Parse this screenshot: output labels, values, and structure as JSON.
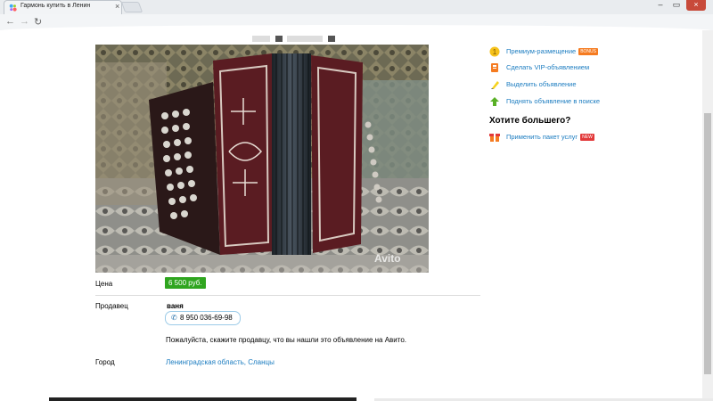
{
  "browser": {
    "tab_title": "Гармонь купить в Ленин",
    "tab_close": "×",
    "window_controls": [
      "–",
      "▭",
      "×"
    ]
  },
  "listing": {
    "price_label": "Цена",
    "price_value": "6 500 руб.",
    "seller_label": "Продавец",
    "seller_name": "ваня",
    "phone": "8 950 036-69-98",
    "seller_note": "Пожалуйста, скажите продавцу, что вы нашли это объявление на Авито.",
    "city_label": "Город",
    "city_value": "Ленинградская область, Сланцы",
    "photo_watermark": "Avito"
  },
  "sidebar": {
    "items": [
      {
        "label": "Премиум-размещение",
        "badge": "BONUS",
        "icon": "premium-icon"
      },
      {
        "label": "Сделать VIP-объявлением",
        "icon": "vip-icon"
      },
      {
        "label": "Выделить объявление",
        "icon": "highlight-icon"
      },
      {
        "label": "Поднять объявление в поиске",
        "icon": "raise-icon"
      }
    ],
    "more_heading": "Хотите большего?",
    "package_link": "Применить пакет услуг",
    "package_badge": "NEW",
    "icon_numeral": "1"
  },
  "colors": {
    "price_green": "#2fa51f",
    "link_blue": "#1b7cc0",
    "bonus_orange": "#f57b20",
    "new_red": "#e2393a"
  }
}
